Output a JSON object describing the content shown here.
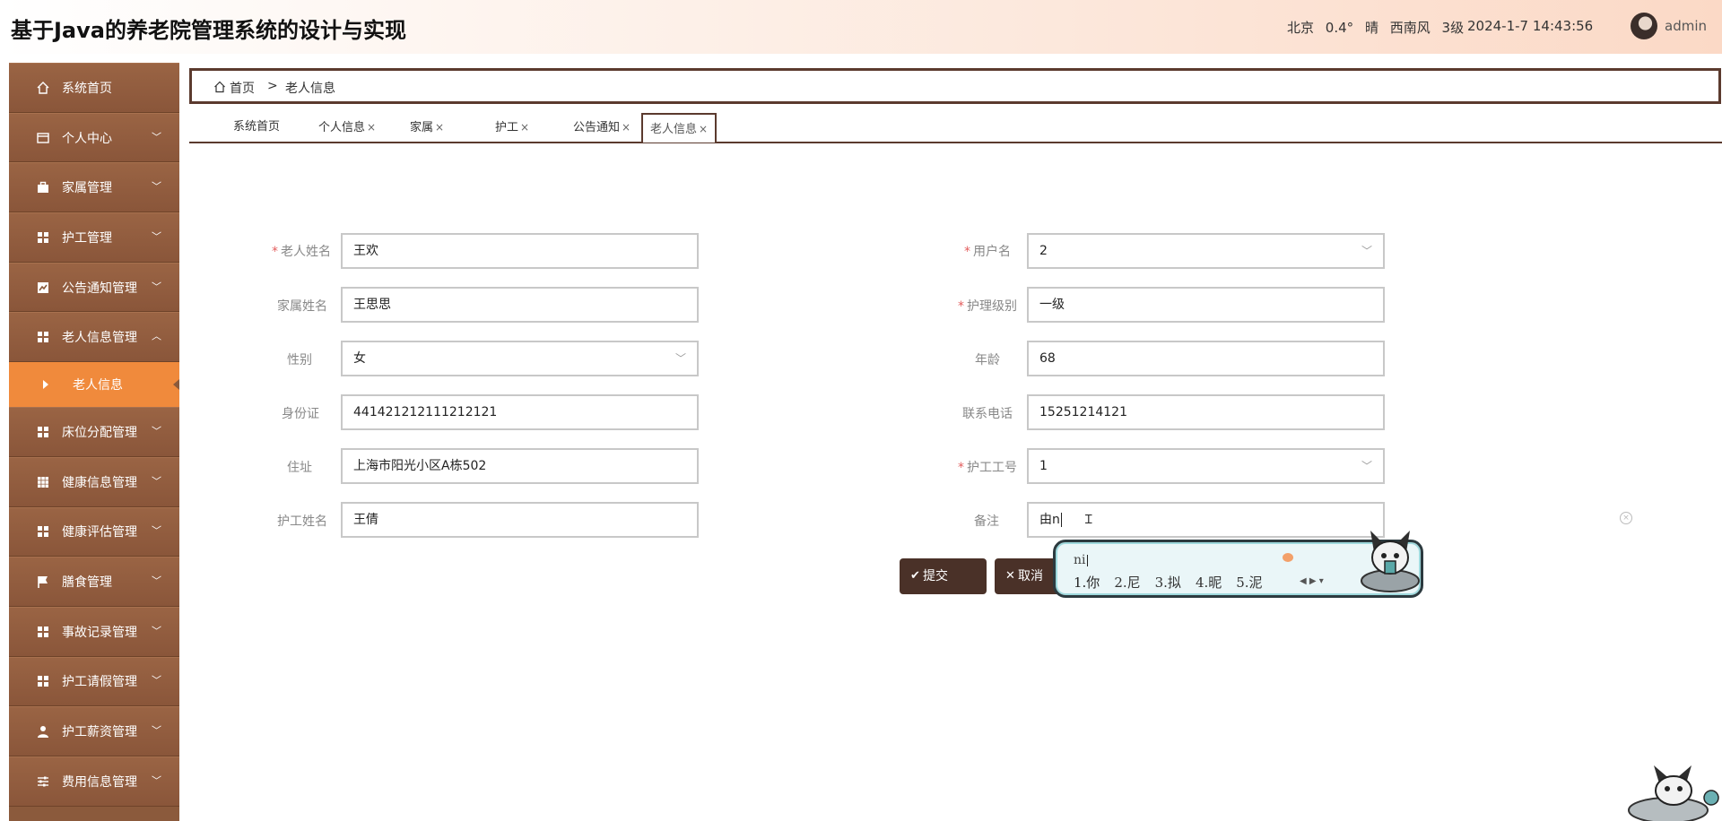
{
  "header": {
    "title": "基于Java的养老院管理系统的设计与实现",
    "weather": {
      "city": "北京",
      "temp": "0.4°",
      "condition": "晴",
      "wind_dir": "西南风",
      "wind_level": "3级"
    },
    "datetime": "2024-1-7 14:43:56",
    "user": "admin"
  },
  "sidebar": {
    "items": [
      {
        "label": "系统首页",
        "icon": "home-icon"
      },
      {
        "label": "个人中心",
        "icon": "wallet-icon"
      },
      {
        "label": "家属管理",
        "icon": "briefcase-icon"
      },
      {
        "label": "护工管理",
        "icon": "grid-icon"
      },
      {
        "label": "公告通知管理",
        "icon": "chart-icon"
      },
      {
        "label": "老人信息管理",
        "icon": "grid-icon"
      },
      {
        "label": "床位分配管理",
        "icon": "grid-icon"
      },
      {
        "label": "健康信息管理",
        "icon": "table-icon"
      },
      {
        "label": "健康评估管理",
        "icon": "grid-icon"
      },
      {
        "label": "膳食管理",
        "icon": "flag-icon"
      },
      {
        "label": "事故记录管理",
        "icon": "grid-icon"
      },
      {
        "label": "护工请假管理",
        "icon": "grid-icon"
      },
      {
        "label": "护工薪资管理",
        "icon": "user-icon"
      },
      {
        "label": "费用信息管理",
        "icon": "sliders-icon"
      }
    ],
    "sub_active": "老人信息"
  },
  "breadcrumb": {
    "home": "首页",
    "sep": ">",
    "current": "老人信息"
  },
  "tabs": [
    {
      "label": "系统首页",
      "closable": false
    },
    {
      "label": "个人信息",
      "closable": true
    },
    {
      "label": "家属",
      "closable": true
    },
    {
      "label": "护工",
      "closable": true
    },
    {
      "label": "公告通知",
      "closable": true
    },
    {
      "label": "老人信息",
      "closable": true,
      "active": true
    }
  ],
  "tab_close_glyph": "×",
  "form": {
    "elder_name": {
      "label": "老人姓名",
      "required": true,
      "value": "王欢"
    },
    "family_name": {
      "label": "家属姓名",
      "required": false,
      "value": "王思思"
    },
    "gender": {
      "label": "性别",
      "required": false,
      "value": "女"
    },
    "id_card": {
      "label": "身份证",
      "required": false,
      "value": "441421212111212121"
    },
    "address": {
      "label": "住址",
      "required": false,
      "value": "上海市阳光小区A栋502"
    },
    "caregiver_name": {
      "label": "护工姓名",
      "required": false,
      "value": "王倩"
    },
    "username": {
      "label": "用户名",
      "required": true,
      "value": "2"
    },
    "care_level": {
      "label": "护理级别",
      "required": true,
      "value": "一级"
    },
    "age": {
      "label": "年龄",
      "required": false,
      "value": "68"
    },
    "phone": {
      "label": "联系电话",
      "required": false,
      "value": "15251214121"
    },
    "caregiver_id": {
      "label": "护工工号",
      "required": true,
      "value": "1"
    },
    "remark": {
      "label": "备注",
      "required": false,
      "value": "由n"
    }
  },
  "buttons": {
    "submit": "提交",
    "cancel": "取消"
  },
  "ime": {
    "pinyin": "ni",
    "candidates": [
      "1.你",
      "2.尼",
      "3.拟",
      "4.昵",
      "5.泥"
    ]
  },
  "colors": {
    "brand_dark": "#5b3a2e",
    "sidebar": "#8b5a3c",
    "active": "#f08a3c",
    "required": "#e35d5d"
  }
}
